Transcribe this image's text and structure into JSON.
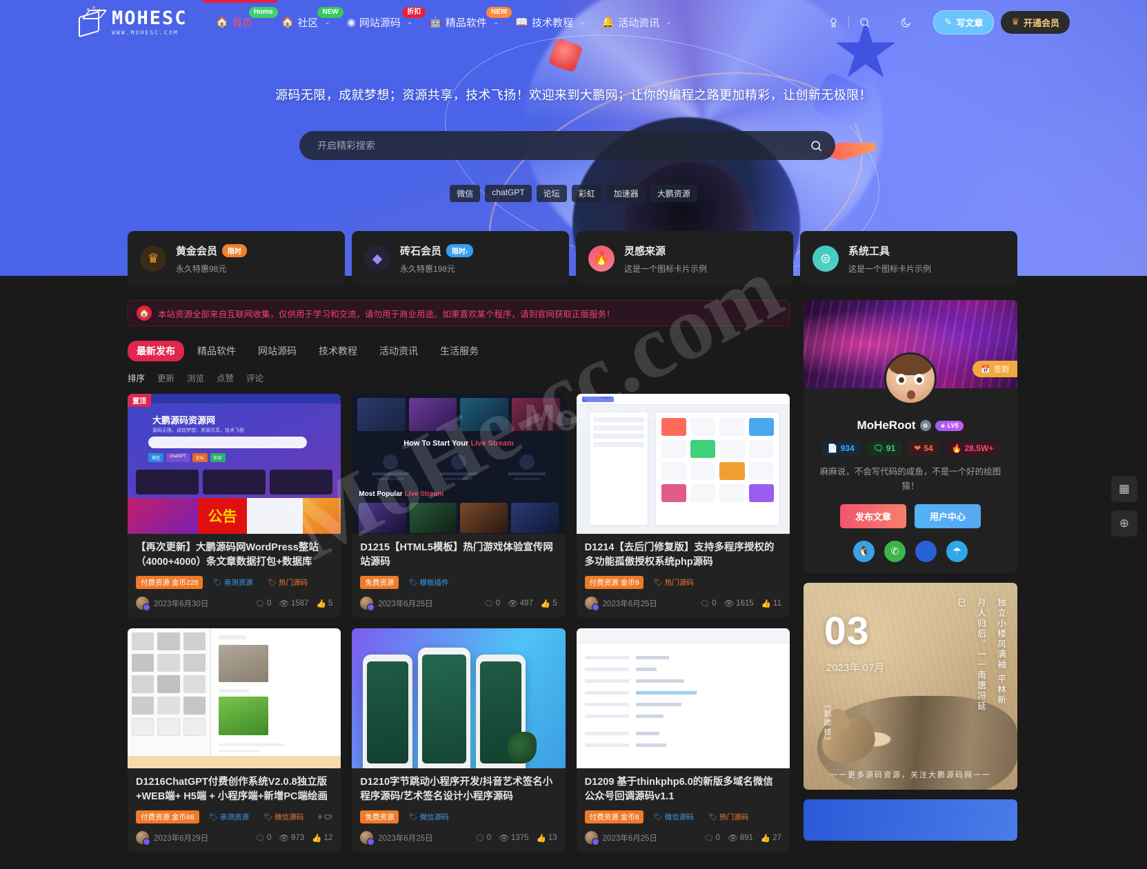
{
  "site": {
    "logo_main": "MOHESC",
    "logo_sub": "WWW.MOHESC.COM",
    "watermark": "MoHe-cc.com",
    "watermark_small": "MoHe-S"
  },
  "nav": {
    "items": [
      {
        "label": "首页",
        "icon": "home-icon",
        "badge": "Home",
        "badge_color": "green",
        "caret": "⌄",
        "active": true
      },
      {
        "label": "社区",
        "icon": "home-icon",
        "badge": "NEW",
        "badge_color": "green2",
        "caret": "⌄",
        "active": false
      },
      {
        "label": "网站源码",
        "icon": "globe-icon",
        "badge": "折扣",
        "badge_color": "red",
        "caret": "⌄",
        "active": false
      },
      {
        "label": "精品软件",
        "icon": "android-icon",
        "badge": "NEW",
        "badge_color": "orange",
        "caret": "⌄",
        "active": false
      },
      {
        "label": "技术教程",
        "icon": "book-icon",
        "badge": "",
        "badge_color": "",
        "caret": "⌄",
        "active": false
      },
      {
        "label": "活动资讯",
        "icon": "bell-icon",
        "badge": "",
        "badge_color": "",
        "caret": "⌄",
        "active": false
      }
    ],
    "write_label": "写文章",
    "vip_label": "开通会员",
    "icons": {
      "medal": "medal-icon",
      "search": "search-icon",
      "moon": "dark-mode-icon"
    }
  },
  "hero": {
    "slogan": "源码无限，成就梦想；资源共享，技术飞扬！欢迎来到大鹏网；让你的编程之路更加精彩，让创新无极限！",
    "search_placeholder": "开启精彩搜索",
    "hot_tags": [
      "微信",
      "chatGPT",
      "论坛",
      "彩虹",
      "加速器",
      "大鹏资源"
    ]
  },
  "features": [
    {
      "title": "黄金会员",
      "pill": "限时",
      "pill_color": "#f0812e",
      "sub": "永久特惠98元",
      "icon": "crown-icon",
      "icon_bg": "#3a2a18",
      "icon_color": "#f0a030"
    },
    {
      "title": "砖石会员",
      "pill": "限时›",
      "pill_color": "#38a0f0",
      "sub": "永久特惠198元",
      "icon": "diamond-icon",
      "icon_bg": "#252238",
      "icon_color": "#9b8cf5"
    },
    {
      "title": "灵感来源",
      "pill": "",
      "pill_color": "",
      "sub": "这是一个图标卡片示例",
      "icon": "fire-icon",
      "icon_bg": "#f2556e",
      "icon_color": "#ffffff"
    },
    {
      "title": "系统工具",
      "pill": "",
      "pill_color": "",
      "sub": "这是一个图标卡片示例",
      "icon": "tool-icon",
      "icon_bg": "#3ec7c2",
      "icon_color": "#ffffff"
    }
  ],
  "notice": {
    "icon": "home-icon",
    "text": "本站资源全部来自互联网收集，仅供用于学习和交流，请勿用于商业用途。如果喜欢某个程序，请到官网获取正版服务！"
  },
  "category_tabs": [
    {
      "label": "最新发布",
      "active": true
    },
    {
      "label": "精品软件",
      "active": false
    },
    {
      "label": "网站源码",
      "active": false
    },
    {
      "label": "技术教程",
      "active": false
    },
    {
      "label": "活动资讯",
      "active": false
    },
    {
      "label": "生活服务",
      "active": false
    }
  ],
  "sort_options": [
    {
      "label": "排序",
      "active": true
    },
    {
      "label": "更新",
      "active": false
    },
    {
      "label": "浏览",
      "active": false
    },
    {
      "label": "点赞",
      "active": false
    },
    {
      "label": "评论",
      "active": false
    }
  ],
  "cards": [
    {
      "flag": "置顶",
      "title": "【再次更新】大鹏源码网WordPress整站（4000+4000）条文章数据打包+数据库",
      "tags": [
        {
          "text": "付费资源 金币228",
          "kind": "pay"
        },
        {
          "text": "亲测资源",
          "kind": "blue"
        },
        {
          "text": "热门源码",
          "kind": "orange"
        }
      ],
      "date": "2023年6月30日",
      "comments": "0",
      "views": "1587",
      "likes": "5",
      "thumb": "th1"
    },
    {
      "flag": "",
      "title": "D1215【HTML5模板】热门游戏体验宣传网站源码",
      "tags": [
        {
          "text": "免费资源",
          "kind": "free"
        },
        {
          "text": "模板插件",
          "kind": "blue"
        }
      ],
      "date": "2023年6月25日",
      "comments": "0",
      "views": "497",
      "likes": "5",
      "thumb": "th2"
    },
    {
      "flag": "",
      "title": "D1214【去后门修复版】支持多程序授权的多功能孤傲授权系统php源码",
      "tags": [
        {
          "text": "付费资源 金币9",
          "kind": "pay"
        },
        {
          "text": "热门源码",
          "kind": "orange"
        }
      ],
      "date": "2023年6月25日",
      "comments": "0",
      "views": "1615",
      "likes": "11",
      "thumb": "th3"
    },
    {
      "flag": "",
      "title": "D1216ChatGPT付费创作系统V2.0.8独立版+WEB端+ H5端 + 小程序端+新增PC端绘画",
      "tags": [
        {
          "text": "付费资源 金币68",
          "kind": "pay"
        },
        {
          "text": "亲测资源",
          "kind": "blue"
        },
        {
          "text": "微信源码",
          "kind": "orange"
        },
        {
          "text": "# ChatG",
          "kind": "plain"
        }
      ],
      "date": "2023年6月29日",
      "comments": "0",
      "views": "973",
      "likes": "12",
      "thumb": "th4"
    },
    {
      "flag": "",
      "title": "D1210字节跳动小程序开发/抖音艺术签名小程序源码/艺术签名设计小程序源码",
      "tags": [
        {
          "text": "免费资源",
          "kind": "free"
        },
        {
          "text": "微信源码",
          "kind": "blue"
        }
      ],
      "date": "2023年6月25日",
      "comments": "0",
      "views": "1375",
      "likes": "13",
      "thumb": "th5"
    },
    {
      "flag": "",
      "title": "D1209 基于thinkphp6.0的新版多域名微信公众号回调源码v1.1",
      "tags": [
        {
          "text": "付费资源 金币8",
          "kind": "pay"
        },
        {
          "text": "微信源码",
          "kind": "blue"
        },
        {
          "text": "热门源码",
          "kind": "orange"
        }
      ],
      "date": "2023年6月25日",
      "comments": "0",
      "views": "891",
      "likes": "27",
      "thumb": "th6"
    }
  ],
  "sidebar": {
    "signin_label": "签到",
    "user": {
      "name": "MoHeRoot",
      "level": "LV5",
      "stats": [
        {
          "value": "934",
          "icon": "document-icon",
          "style": "s-blue"
        },
        {
          "value": "91",
          "icon": "comment-icon",
          "style": "s-green"
        },
        {
          "value": "54",
          "icon": "heart-icon",
          "style": "s-red"
        },
        {
          "value": "28.5W+",
          "icon": "fire-icon",
          "style": "s-pink"
        }
      ],
      "desc": "麻麻说，不会写代码的咸鱼，不是一个好的绘图猿！",
      "publish_label": "发布文章",
      "center_label": "用户中心",
      "socials": [
        {
          "name": "qq-icon",
          "glyph": "🐧",
          "style": "qq"
        },
        {
          "name": "wechat-icon",
          "glyph": "✆",
          "style": "wx"
        },
        {
          "name": "baidu-icon",
          "glyph": "🐾",
          "style": "bd"
        },
        {
          "name": "weibo-icon",
          "glyph": "👤",
          "style": "wb"
        }
      ]
    },
    "poem": {
      "day": "03",
      "year_month": "2023年 07月",
      "verses": [
        "独立小楼风满袖 平林新",
        "月人归后。一一南唐冯延",
        "巳"
      ],
      "seal": "《鹊踏枝》",
      "footer": "一一更多源码资源，关注大鹏源码网一一"
    }
  },
  "rail": [
    {
      "name": "qrcode-icon",
      "glyph": "▦"
    },
    {
      "name": "add-icon",
      "glyph": "⊕"
    }
  ]
}
